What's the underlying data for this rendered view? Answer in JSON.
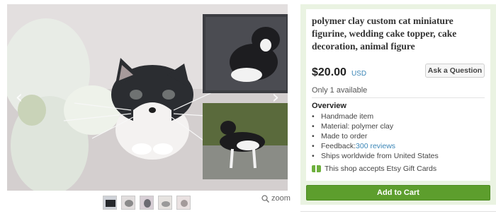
{
  "listing": {
    "title": "polymer clay custom cat miniature figurine, wedding cake topper, cake decoration, animal figure",
    "price": "$20.00",
    "currency": "USD",
    "ask_button": "Ask a Question",
    "availability": "Only 1 available",
    "overview_heading": "Overview",
    "overview": {
      "item1": "Handmade item",
      "item2": "Material: polymer clay",
      "item3": "Made to order",
      "feedback_label": "Feedback: ",
      "feedback_link": "300 reviews",
      "item5": "Ships worldwide from United States"
    },
    "gift_cards": "This shop accepts Etsy Gift Cards",
    "cart_button": "Add to Cart"
  },
  "gallery": {
    "zoom_label": "zoom",
    "thumbnail_count": 5,
    "prev_icon": "chevron-left-icon",
    "next_icon": "chevron-right-icon"
  },
  "colors": {
    "accent_green": "#5d9e2d",
    "panel_bg": "#eaf3e2",
    "link_blue": "#3b86b7"
  }
}
